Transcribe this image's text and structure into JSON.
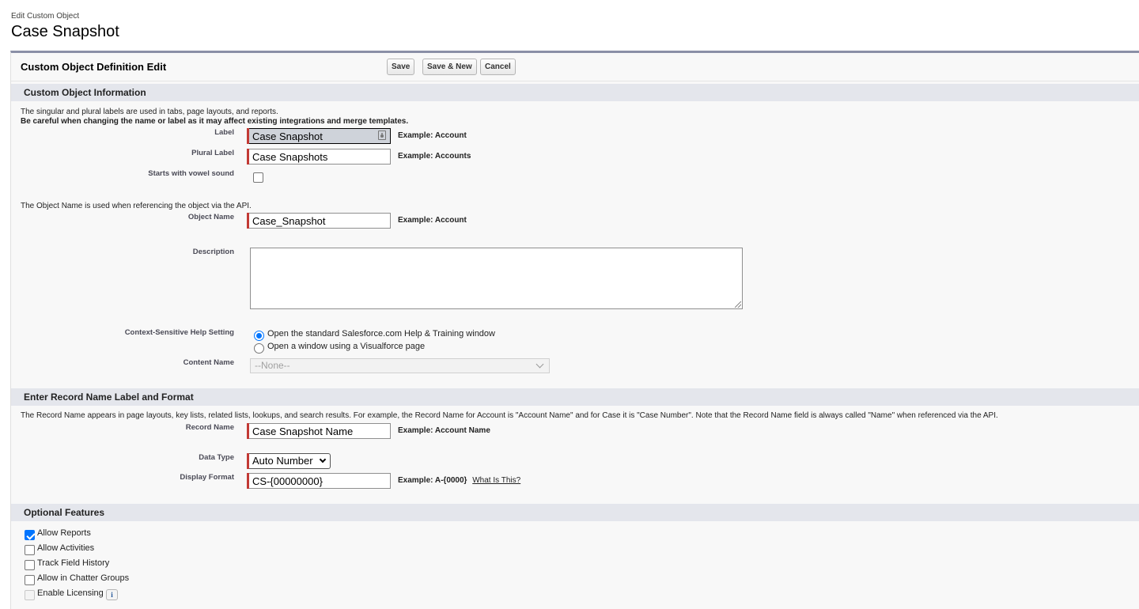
{
  "header": {
    "page_type": "Edit Custom Object",
    "title": "Case Snapshot"
  },
  "panel": {
    "title": "Custom Object Definition Edit",
    "buttons": {
      "save": "Save",
      "save_new": "Save & New",
      "cancel": "Cancel"
    }
  },
  "custom_object_info": {
    "section_title": "Custom Object Information",
    "intro_line1": "The singular and plural labels are used in tabs, page layouts, and reports.",
    "intro_line2": "Be careful when changing the name or label as it may affect existing integrations and merge templates.",
    "label": {
      "label": "Label",
      "value": "Case Snapshot",
      "example": "Example:  Account"
    },
    "plural_label": {
      "label": "Plural Label",
      "value": "Case Snapshots",
      "example": "Example:  Accounts"
    },
    "vowel": {
      "label": "Starts with vowel sound",
      "checked": false
    },
    "api_intro": "The Object Name is used when referencing the object via the API.",
    "object_name": {
      "label": "Object Name",
      "value": "Case_Snapshot",
      "example": "Example:  Account"
    },
    "description": {
      "label": "Description",
      "value": ""
    },
    "help_setting": {
      "label": "Context-Sensitive Help Setting",
      "options": [
        "Open the standard Salesforce.com Help & Training window",
        "Open a window using a Visualforce page"
      ],
      "selected_index": 0
    },
    "content_name": {
      "label": "Content Name",
      "value": "--None--"
    }
  },
  "record_name": {
    "section_title": "Enter Record Name Label and Format",
    "intro": "The Record Name appears in page layouts, key lists, related lists, lookups, and search results. For example, the Record Name for Account is \"Account Name\" and for Case it is \"Case Number\". Note that the Record Name field is always called \"Name\" when referenced via the API.",
    "record_name": {
      "label": "Record Name",
      "value": "Case Snapshot Name",
      "example": "Example:  Account Name"
    },
    "data_type": {
      "label": "Data Type",
      "value": "Auto Number"
    },
    "display_format": {
      "label": "Display Format",
      "value": "CS-{00000000}",
      "example": "Example:  A-{0000}",
      "link": "What Is This?"
    }
  },
  "optional_features": {
    "section_title": "Optional Features",
    "items": [
      {
        "label": "Allow Reports",
        "checked": true
      },
      {
        "label": "Allow Activities",
        "checked": false
      },
      {
        "label": "Track Field History",
        "checked": false
      },
      {
        "label": "Allow in Chatter Groups",
        "checked": false
      },
      {
        "label": "Enable Licensing",
        "checked": false,
        "disabled": true,
        "info_icon": "i"
      }
    ]
  }
}
